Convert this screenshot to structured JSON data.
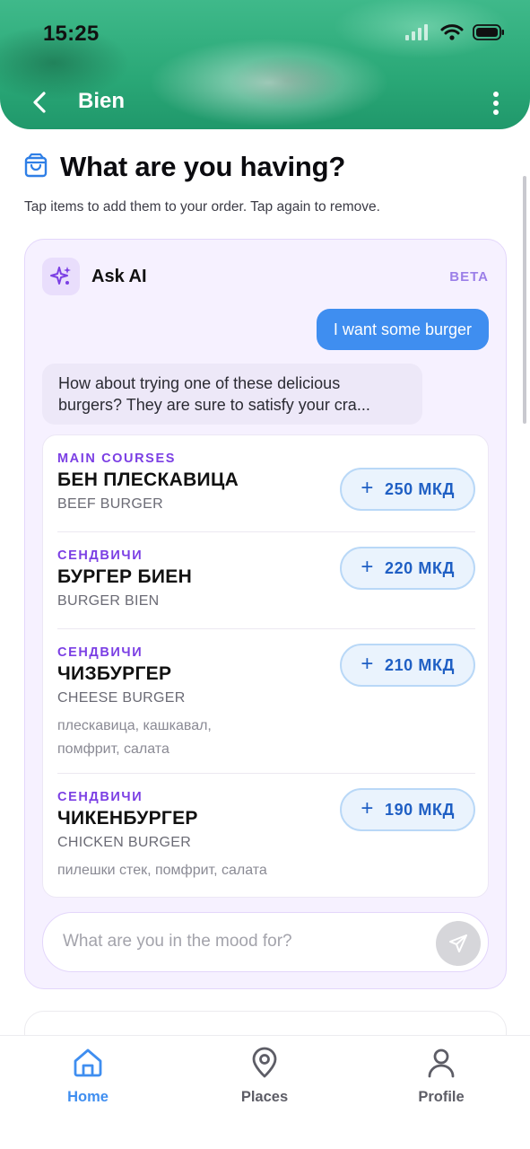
{
  "status_bar": {
    "time": "15:25"
  },
  "header": {
    "title": "Bien",
    "icons": [
      "back-chevron-icon",
      "more-vertical-icon"
    ]
  },
  "page": {
    "title": "What are you having?",
    "subtitle": "Tap items to add them to your order. Tap again to remove.",
    "title_icon": "shopping-bag-icon"
  },
  "ai": {
    "title": "Ask AI",
    "badge": "BETA",
    "icon": "sparkles-icon",
    "user_message": "I want some burger",
    "assistant_line1": "How about trying one of these delicious",
    "assistant_line2": "burgers? They are sure to satisfy your cra...",
    "items": [
      {
        "category": "MAIN COURSES",
        "name": "БЕН ПЛЕСКАВИЦА",
        "english": "BEEF BURGER",
        "description": "",
        "price": "250 МКД"
      },
      {
        "category": "СЕНДВИЧИ",
        "name": "БУРГЕР БИЕН",
        "english": "BURGER BIEN",
        "description": "",
        "price": "220 МКД"
      },
      {
        "category": "СЕНДВИЧИ",
        "name": "ЧИЗБУРГЕР",
        "english": "CHEESE BURGER",
        "description": "плескавица, кашкавал, помфрит, салата",
        "price": "210 МКД"
      },
      {
        "category": "СЕНДВИЧИ",
        "name": "ЧИКЕНБУРГЕР",
        "english": "CHICKEN BURGER",
        "description": "пилешки стек, помфрит, салата",
        "price": "190 МКД"
      }
    ],
    "input_placeholder": "What are you in the mood for?"
  },
  "bottom_nav": {
    "items": [
      {
        "label": "Home",
        "icon": "home-icon",
        "active": true
      },
      {
        "label": "Places",
        "icon": "map-pin-icon",
        "active": false
      },
      {
        "label": "Profile",
        "icon": "user-icon",
        "active": false
      }
    ]
  },
  "colors": {
    "accent": "#3f8ef0",
    "ai_purple": "#7b3fe4",
    "header_green": "#2aa877"
  }
}
